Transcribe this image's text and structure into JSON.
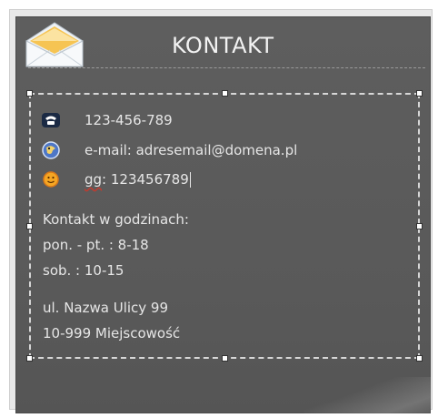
{
  "widget": {
    "title": "KONTAKT",
    "contacts": [
      {
        "icon": "phone-icon",
        "text": "123-456-789"
      },
      {
        "icon": "email-icon",
        "text": "e-mail: adresemail@domena.pl"
      },
      {
        "icon": "gadu-gadu-icon",
        "label": "gg",
        "text": ": 123456789"
      }
    ],
    "hours_heading": "Kontakt w godzinach:",
    "hours": [
      "pon. - pt. : 8-18",
      "sob. : 10-15"
    ],
    "address": [
      "ul. Nazwa Ulicy 99",
      "10-999 Miejscowość"
    ]
  },
  "colors": {
    "panel": "#5c5c5c",
    "text": "#e6e6e6",
    "title": "#f2f2f2"
  }
}
